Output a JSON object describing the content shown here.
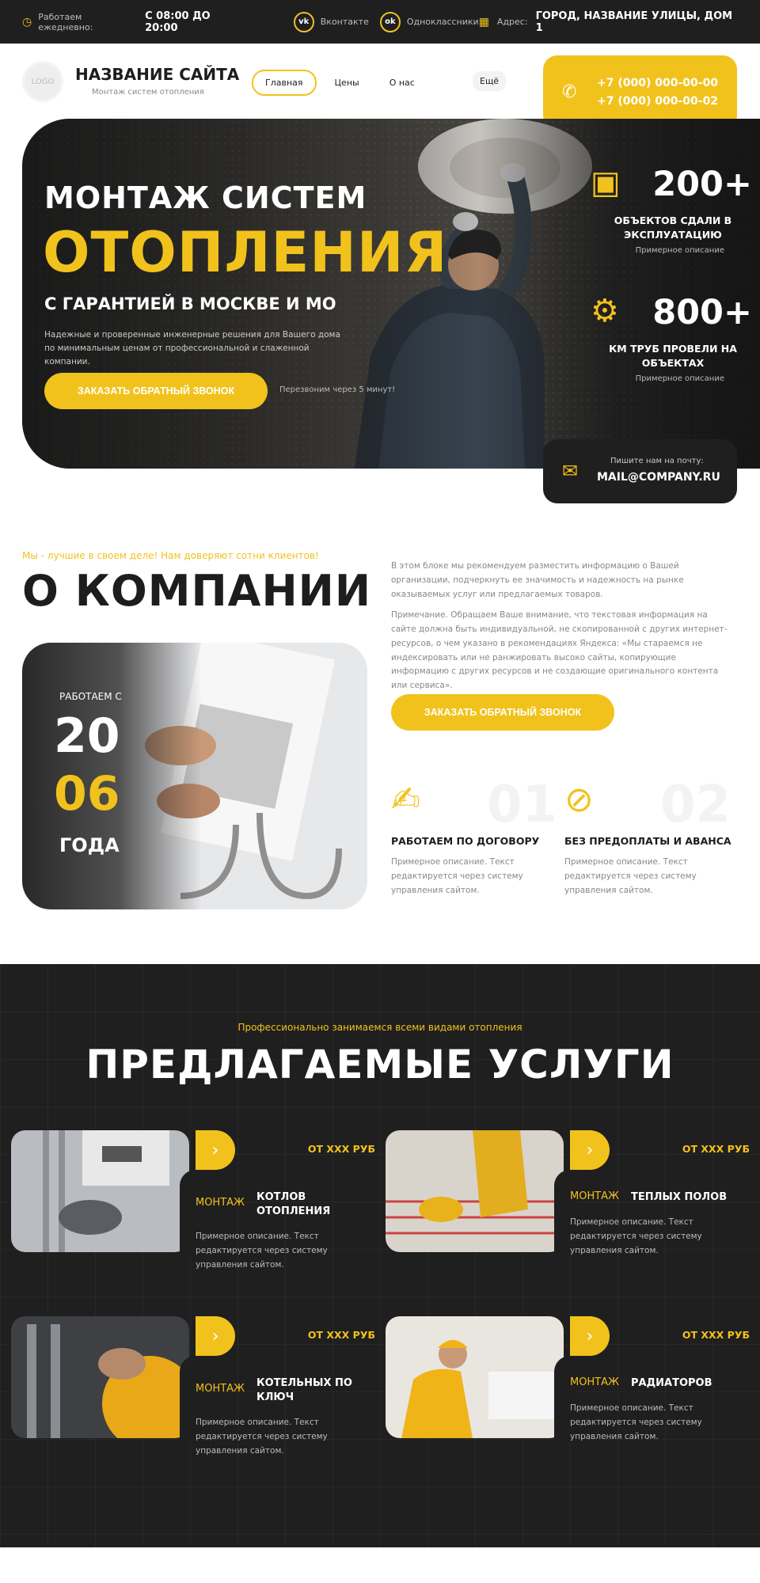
{
  "topbar": {
    "hours_label": "Работаем ежедневно:",
    "hours_value": "С 08:00 ДО 20:00",
    "social": [
      {
        "icon": "vk-icon",
        "label": "Вконтакте"
      },
      {
        "icon": "ok-icon",
        "label": "Одноклассники"
      }
    ],
    "address_label": "Адрес:",
    "address_value": "ГОРОД, НАЗВАНИЕ УЛИЦЫ, ДОМ 1"
  },
  "header": {
    "logo_text": "LOGO",
    "site_name": "НАЗВАНИЕ САЙТА",
    "site_sub": "Монтаж систем отопления",
    "nav": [
      "Главная",
      "Цены",
      "О нас"
    ],
    "more": "Ещё",
    "phones": [
      "+7 (000) 000-00-00",
      "+7 (000) 000-00-02"
    ]
  },
  "hero": {
    "line1": "МОНТАЖ СИСТЕМ",
    "line2": "ОТОПЛЕНИЯ",
    "line3": "С ГАРАНТИЕЙ В МОСКВЕ И МО",
    "desc": "Надежные и проверенные инженерные решения для Вашего дома по минимальным ценам от профессиональной и слаженной компании.",
    "cta": "ЗАКАЗАТЬ ОБРАТНЫЙ ЗВОНОК",
    "note": "Перезвоним через 5 минут!",
    "stats": [
      {
        "num": "200+",
        "label": "ОБЪЕКТОВ СДАЛИ В ЭКСПЛУАТАЦИЮ",
        "sub": "Примерное описание"
      },
      {
        "num": "800+",
        "label": "КМ ТРУБ ПРОВЕЛИ НА ОБЪЕКТАХ",
        "sub": "Примерное описание"
      }
    ],
    "mail_label": "Пишите нам на почту:",
    "mail": "MAIL@COMPANY.RU"
  },
  "about": {
    "tag": "Мы - лучшие в своем деле! Нам доверяют сотни клиентов!",
    "title": "О КОМПАНИИ",
    "since_label": "РАБОТАЕМ С",
    "year_top": "20",
    "year_bottom": "06",
    "year_word": "ГОДА",
    "p1": "В этом блоке мы рекомендуем разместить информацию о Вашей организации, подчеркнуть ее значимость и надежность на рынке оказываемых услуг или предлагаемых товаров.",
    "p2": "Примечание. Обращаем Ваше внимание, что текстовая информация на сайте должна быть индивидуальной, не скопированной с других интернет-ресурсов, о чем указано в рекомендациях Яндекса: «Мы стараемся не индексировать или не ранжировать высоко сайты, копирующие информацию с других ресурсов и не создающие оригинального контента или сервиса».",
    "cta": "ЗАКАЗАТЬ ОБРАТНЫЙ ЗВОНОК",
    "features": [
      {
        "num": "01",
        "title": "РАБОТАЕМ ПО ДОГОВОРУ",
        "desc": "Примерное описание. Текст редактируется через систему управления сайтом."
      },
      {
        "num": "02",
        "title": "БЕЗ ПРЕДОПЛАТЫ И АВАНСА",
        "desc": "Примерное описание. Текст редактируется через систему управления сайтом."
      }
    ]
  },
  "services": {
    "tag": "Профессионально занимаемся всеми видами отопления",
    "title": "ПРЕДЛАГАЕМЫЕ УСЛУГИ",
    "items": [
      {
        "price": "ОТ ХХХ РУБ",
        "kind": "МОНТАЖ",
        "name": "КОТЛОВ ОТОПЛЕНИЯ",
        "desc": "Примерное описание. Текст редактируется через систему управления сайтом."
      },
      {
        "price": "ОТ ХХХ РУБ",
        "kind": "МОНТАЖ",
        "name": "ТЕПЛЫХ ПОЛОВ",
        "desc": "Примерное описание. Текст редактируется через систему управления сайтом."
      },
      {
        "price": "ОТ ХХХ РУБ",
        "kind": "МОНТАЖ",
        "name": "КОТЕЛЬНЫХ ПО КЛЮЧ",
        "desc": "Примерное описание. Текст редактируется через систему управления сайтом."
      },
      {
        "price": "ОТ ХХХ РУБ",
        "kind": "МОНТАЖ",
        "name": "РАДИАТОРОВ",
        "desc": "Примерное описание. Текст редактируется через систему управления сайтом."
      }
    ]
  },
  "colors": {
    "accent": "#f2c21c",
    "dark": "#1f1f1f"
  }
}
